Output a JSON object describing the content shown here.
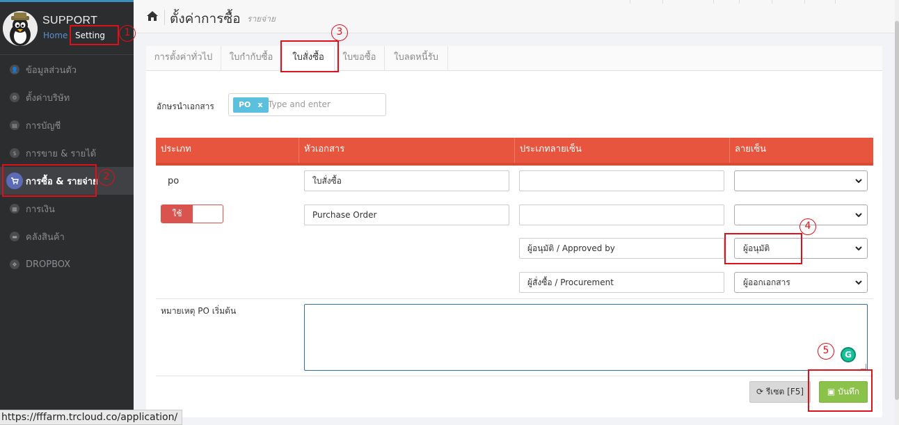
{
  "brand": {
    "title": "SUPPORT",
    "home": "Home",
    "setting": "Setting"
  },
  "menu": [
    {
      "label": "ข้อมูลส่วนตัว",
      "icon": "user-icon",
      "glyph": "👤"
    },
    {
      "label": "ตั้งค่าบริษัท",
      "icon": "gear-icon",
      "glyph": "⚙"
    },
    {
      "label": "การบัญชี",
      "icon": "book-icon",
      "glyph": "▤"
    },
    {
      "label": "การขาย & รายได้",
      "icon": "dollar-icon",
      "glyph": "$"
    },
    {
      "label": "การซื้อ & รายจ่าย",
      "icon": "cart-icon",
      "glyph": "🛒"
    },
    {
      "label": "การเงิน",
      "icon": "calendar-icon",
      "glyph": "▦"
    },
    {
      "label": "คลังสินค้า",
      "icon": "truck-icon",
      "glyph": "▬"
    },
    {
      "label": "DROPBOX",
      "icon": "dropbox-icon",
      "glyph": "❖"
    }
  ],
  "header": {
    "title": "ตั้งค่าการซื้อ",
    "subtitle": "รายจ่าย"
  },
  "tabs": [
    "การตั้งค่าทั่วไป",
    "ใบกำกับซื้อ",
    "ใบสั่งซื้อ",
    "ใบขอซื้อ",
    "ใบลดหนี้รับ"
  ],
  "active_tab": "ใบสั่งซื้อ",
  "prefix": {
    "label": "อักษรนำเอกสาร",
    "tag": "PO",
    "tag_remove": "x",
    "placeholder": "Type and enter"
  },
  "table": {
    "headers": [
      "ประเภท",
      "หัวเอกสาร",
      "ประเภทลายเซ็น",
      "ลายเซ็น"
    ],
    "type_value": "po",
    "toggle_label": "ใช้",
    "doc_title_th": "ใบสั่งซื้อ",
    "doc_title_en": "Purchase Order",
    "sign_type_1": "",
    "sign_type_2": "",
    "sign_type_3": "ผู้อนุมัติ / Approved by",
    "sign_type_4": "ผู้สั่งซื้อ / Procurement",
    "signature_1": "",
    "signature_2": "",
    "signature_3": "ผู้อนุมัติ",
    "signature_4": "ผู้ออกเอกสาร"
  },
  "note": {
    "label": "หมายเหตุ PO เริ่มต้น",
    "value": ""
  },
  "buttons": {
    "reset": "รีเซต [F5]",
    "save": "บันทึก"
  },
  "annotations": [
    "1",
    "2",
    "3",
    "4",
    "5"
  ],
  "status_url": "https://fffarm.trcloud.co/application/",
  "colors": {
    "accent": "#e8553e",
    "save": "#8bc34a",
    "sidebar": "#2b2d2f",
    "annotation": "#e0101a"
  }
}
